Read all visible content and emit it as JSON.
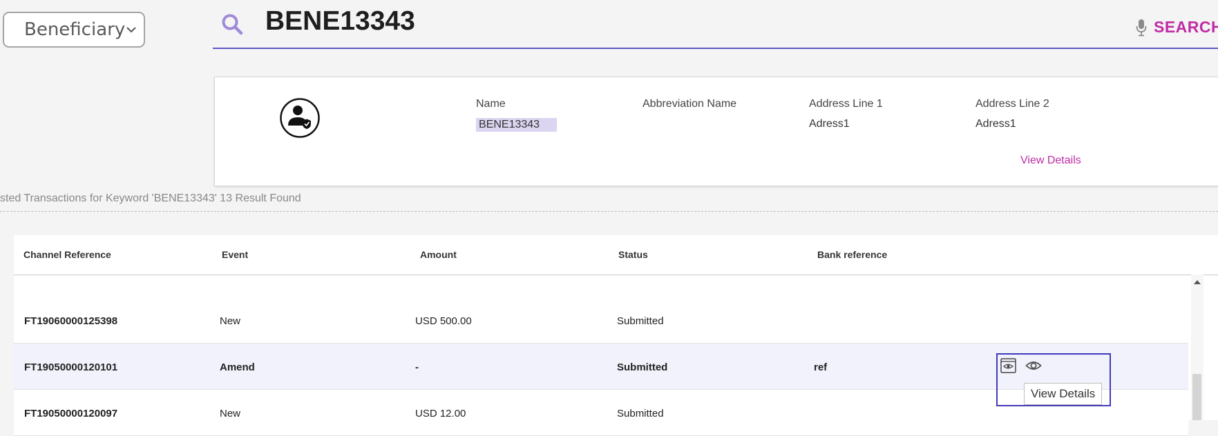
{
  "search": {
    "category": "Beneficiary",
    "query": "BENE13343",
    "button_label": "SEARCH"
  },
  "beneficiary": {
    "fields": [
      {
        "label": "Name",
        "value": "BENE13343"
      },
      {
        "label": "Abbreviation Name",
        "value": ""
      },
      {
        "label": "Address Line 1",
        "value": "Adress1"
      },
      {
        "label": "Address Line 2",
        "value": "Adress1"
      }
    ],
    "view_details": "View Details"
  },
  "results_text": "sted Transactions for Keyword 'BENE13343' 13 Result Found",
  "table": {
    "columns": [
      "Channel Reference",
      "Event",
      "Amount",
      "Status",
      "Bank reference"
    ],
    "rows": [
      {
        "channel_ref": "FT19060000125398",
        "event": "New",
        "amount": "USD 500.00",
        "status": "Submitted",
        "bank_ref": ""
      },
      {
        "channel_ref": "FT19050000120101",
        "event": "Amend",
        "amount": "-",
        "status": "Submitted",
        "bank_ref": "ref"
      },
      {
        "channel_ref": "FT19050000120097",
        "event": "New",
        "amount": "USD 12.00",
        "status": "Submitted",
        "bank_ref": ""
      }
    ],
    "tooltip": "View Details"
  },
  "colors": {
    "accent": "#c02ba4",
    "underline": "#5b55c4",
    "highlight_box": "#3f3ab8",
    "search_icon": "#a08ad8"
  }
}
